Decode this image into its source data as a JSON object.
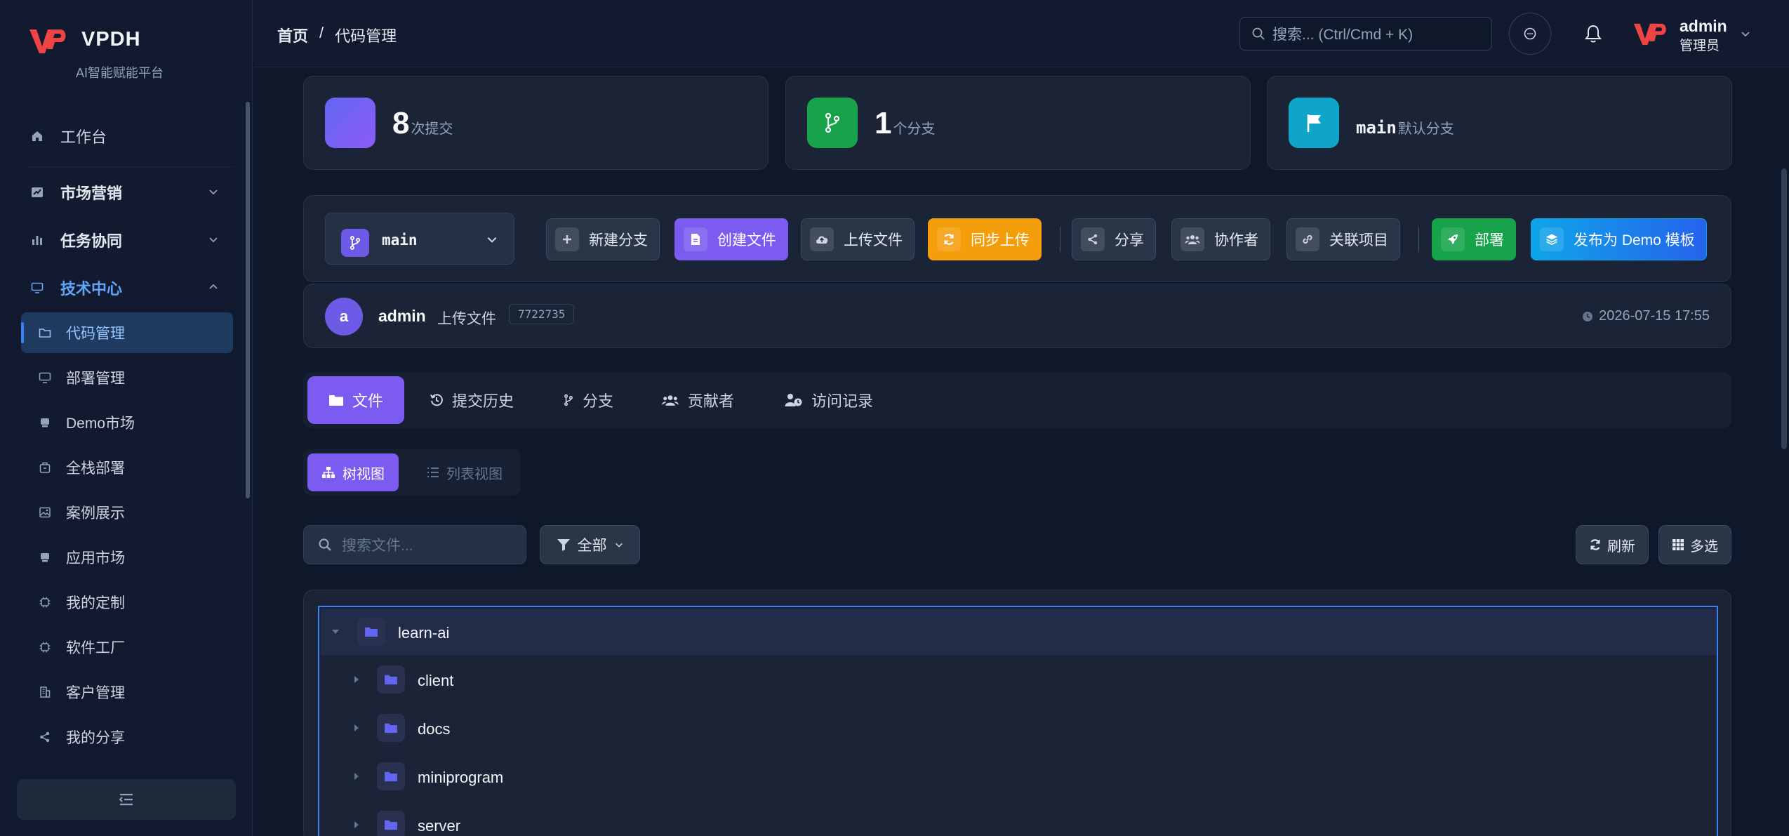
{
  "app": {
    "brand": "VPDH",
    "tagline": "AI智能赋能平台"
  },
  "sidebar": {
    "items": [
      {
        "label": "工作台",
        "icon": "home-icon"
      },
      {
        "label": "市场营销",
        "icon": "chart-icon"
      },
      {
        "label": "任务协同",
        "icon": "bar-chart-icon"
      },
      {
        "label": "技术中心",
        "icon": "monitor-icon"
      }
    ],
    "sub_items": [
      {
        "label": "代码管理",
        "icon": "folder-icon",
        "active": true
      },
      {
        "label": "部署管理",
        "icon": "monitor-icon"
      },
      {
        "label": "Demo市场",
        "icon": "store-icon"
      },
      {
        "label": "全栈部署",
        "icon": "package-icon"
      },
      {
        "label": "案例展示",
        "icon": "image-icon"
      },
      {
        "label": "应用市场",
        "icon": "store-icon"
      },
      {
        "label": "我的定制",
        "icon": "chip-icon"
      },
      {
        "label": "软件工厂",
        "icon": "chip-icon"
      },
      {
        "label": "客户管理",
        "icon": "building-icon"
      },
      {
        "label": "我的分享",
        "icon": "share-icon"
      }
    ]
  },
  "header": {
    "breadcrumb_home": "首页",
    "breadcrumb_sep": "/",
    "breadcrumb_current": "代码管理",
    "search_placeholder": "搜索... (Ctrl/Cmd + K)",
    "user_name": "admin",
    "user_role": "管理员"
  },
  "stats": {
    "commits_value": "8",
    "commits_unit": "次提交",
    "branches_value": "1",
    "branches_unit": "个分支",
    "default_branch_value": "main",
    "default_branch_unit": "默认分支"
  },
  "toolbar": {
    "branch": "main",
    "new_branch": "新建分支",
    "create_file": "创建文件",
    "upload_file": "上传文件",
    "sync_upload": "同步上传",
    "share": "分享",
    "collaborators": "协作者",
    "link_project": "关联项目",
    "deploy": "部署",
    "publish_demo": "发布为 Demo 模板"
  },
  "last_commit": {
    "avatar_letter": "a",
    "user": "admin",
    "message": "上传文件",
    "hash": "7722735",
    "time": "2026-07-15 17:55"
  },
  "tabs": [
    {
      "label": "文件",
      "active": true
    },
    {
      "label": "提交历史"
    },
    {
      "label": "分支"
    },
    {
      "label": "贡献者"
    },
    {
      "label": "访问记录"
    }
  ],
  "view_toggle": {
    "tree": "树视图",
    "list": "列表视图"
  },
  "file_filter": {
    "search_placeholder": "搜索文件...",
    "filter_label": "全部",
    "refresh": "刷新",
    "multi_select": "多选"
  },
  "tree": {
    "root": "learn-ai",
    "children": [
      "client",
      "docs",
      "miniprogram",
      "server"
    ]
  },
  "colors": {
    "accent": "#7c5cf0",
    "brand_red": "#e5484d",
    "active_nav": "#60a5fa"
  }
}
